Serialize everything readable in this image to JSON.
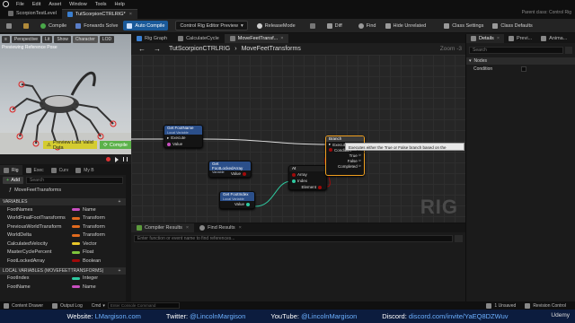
{
  "menu": [
    "File",
    "Edit",
    "Asset",
    "Window",
    "Tools",
    "Help"
  ],
  "asset_tabs": [
    {
      "label": "ScorpionTestLevel",
      "active": false
    },
    {
      "label": "TutScorpionCTRLRIG*",
      "active": true
    }
  ],
  "parent_class": "Parent class: Control Rig",
  "toolbar": {
    "compile": "Compile",
    "forwards_solve": "Forwards Solve",
    "auto_compile": "Auto Compile",
    "preview_mode": "Control Rig Editor Preview",
    "release_mode": "ReleaseMode",
    "diff": "Diff",
    "find": "Find",
    "hide_unrelated": "Hide Unrelated",
    "class_settings": "Class Settings",
    "class_defaults": "Class Defaults"
  },
  "viewport": {
    "buttons": [
      "Perspective",
      "Lit",
      "Show",
      "Character",
      "LOD"
    ],
    "preview_label": "Previewing Reference Pose",
    "preview_btn": "Preview Last Valid Data",
    "compile_btn": "Compile"
  },
  "left_panel": {
    "tabs": [
      "Rig",
      "Exec",
      "Curv",
      "My B"
    ],
    "add_label": "Add",
    "search_placeholder": "Search",
    "graph_item": "MoveFeetTransforms",
    "variables_header": "VARIABLES",
    "variables": [
      {
        "name": "FootNames",
        "type": "Name",
        "color": "#c84fc0"
      },
      {
        "name": "WorldFinalFootTransforms",
        "type": "Transform",
        "color": "#e06a1e"
      },
      {
        "name": "PreviousWorldTransform",
        "type": "Transform",
        "color": "#e06a1e"
      },
      {
        "name": "WorldDelta",
        "type": "Transform",
        "color": "#e06a1e"
      },
      {
        "name": "CalculatedVelocity",
        "type": "Vector",
        "color": "#e8c62a"
      },
      {
        "name": "MasterCyclePercent",
        "type": "Float",
        "color": "#7ec43c"
      },
      {
        "name": "FootLockedArray",
        "type": "Boolean",
        "color": "#a10a0a"
      }
    ],
    "local_header": "LOCAL VARIABLES (MOVEFEETTRANSFORMS)",
    "local_variables": [
      {
        "name": "FootIndex",
        "type": "Integer",
        "color": "#2ec9a0"
      },
      {
        "name": "FootName",
        "type": "Name",
        "color": "#c84fc0"
      }
    ]
  },
  "graph_tabs": [
    "Rig Graph",
    "CalculateCycle",
    "MoveFeetTransf..."
  ],
  "breadcrumb": [
    "TutScorpionCTRLRIG",
    "MoveFeetTransforms"
  ],
  "zoom": "Zoom -3",
  "watermark": "RIG",
  "nodes": {
    "get_foot_name": {
      "title": "Get FootName",
      "sub": "Local Variable",
      "pins": [
        "Execute",
        "Value"
      ]
    },
    "get_foot_locked": {
      "title": "Get FootLockedArray",
      "sub": "Variable",
      "pins": [
        "Value"
      ]
    },
    "get_foot_index": {
      "title": "Get FootIndex",
      "sub": "Local Variable",
      "pins": [
        "Value"
      ]
    },
    "at": {
      "title": "At",
      "pins": [
        "Array",
        "Index",
        "Element"
      ]
    },
    "branch": {
      "title": "Branch",
      "pins": [
        "Execute",
        "Condition",
        "True",
        "False",
        "Completed"
      ]
    }
  },
  "tooltip": "Executes either the True or False branch based on the condition",
  "compiler": {
    "tabs": [
      "Compiler Results",
      "Find Results"
    ],
    "search_placeholder": "Enter function or event name to find references..."
  },
  "details": {
    "tabs": [
      "Details",
      "Previ...",
      "Anima..."
    ],
    "search_placeholder": "Search",
    "section": "Nodes",
    "row": "Condition"
  },
  "status": {
    "content_drawer": "Content Drawer",
    "output_log": "Output Log",
    "cmd": "Cmd",
    "cmd_placeholder": "Enter Console Command",
    "unsaved": "1 Unsaved",
    "revision": "Revision Control"
  },
  "banner": {
    "website_label": "Website:",
    "website": "LMargison.com",
    "twitter_label": "Twitter:",
    "twitter": "@LincolnMargison",
    "youtube_label": "YouTube:",
    "youtube": "@LincolnMargison",
    "discord_label": "Discord:",
    "discord": "discord.com/invite/YaEQ8DZWuv",
    "udemy": "Udemy"
  }
}
